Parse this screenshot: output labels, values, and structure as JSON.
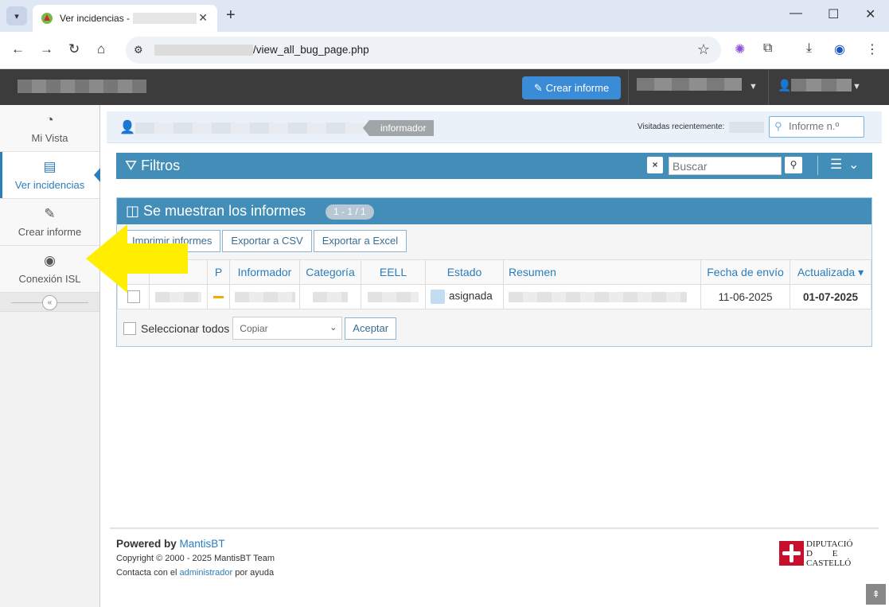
{
  "browser": {
    "tab_title": "Ver incidencias - ",
    "url_path": "/view_all_bug_page.php"
  },
  "navbar": {
    "create_button": "Crear informe"
  },
  "sidebar": {
    "items": [
      {
        "label": "Mi Vista"
      },
      {
        "label": "Ver incidencias"
      },
      {
        "label": "Crear informe"
      },
      {
        "label": "Conexión ISL"
      }
    ],
    "collapse_icon": "«"
  },
  "breadcrumbs": {
    "role": "informador",
    "recently_visited": "Visitadas recientemente:",
    "issue_search_placeholder": "Informe n.º"
  },
  "filters": {
    "title": "Filtros",
    "clear": "×",
    "search_placeholder": "Buscar"
  },
  "results": {
    "title": "Se muestran los informes",
    "count": "1 - 1 / 1",
    "toolbar": [
      "Imprimir informes",
      "Exportar a CSV",
      "Exportar a Excel"
    ],
    "columns": [
      "",
      "",
      "P",
      "Informador",
      "Categoría",
      "EELL",
      "Estado",
      "Resumen",
      "Fecha de envío",
      "Actualizada ▾"
    ],
    "rows": [
      {
        "status": "asignada",
        "submitted": "11-06-2025",
        "updated": "01-07-2025"
      }
    ],
    "select_all": "Seleccionar todos",
    "action_select": "Copiar",
    "accept": "Aceptar"
  },
  "footer": {
    "powered_by": "Powered by",
    "mantis": "MantisBT",
    "copyright": "Copyright © 2000 - 2025 MantisBT Team",
    "contact_pre": "Contacta con el",
    "contact_link": "administrador",
    "contact_post": "por ayuda",
    "logo_lines": [
      "DIPUTACIÓ",
      "D         E",
      "CASTELLÓ"
    ]
  },
  "colors": {
    "accent": "#438eb9",
    "navbar": "#3c3c3c",
    "arrow": "#ffee00",
    "status_assigned": "#c3dcf2"
  }
}
